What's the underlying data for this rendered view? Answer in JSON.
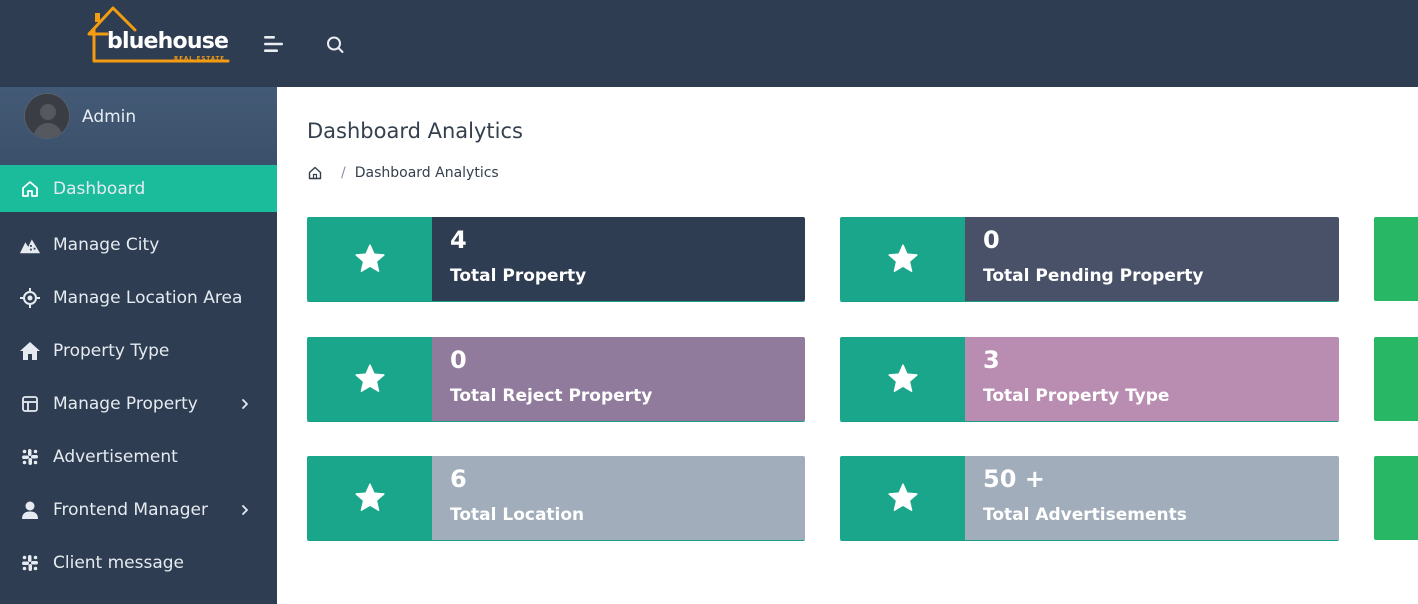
{
  "brand": {
    "name": "bluehouse",
    "tagline": "REAL ESTATE",
    "accent": "#f39c12"
  },
  "topbar": {
    "menu_icon": "menu-icon",
    "search_icon": "search-icon"
  },
  "user": {
    "name": "Admin"
  },
  "nav": [
    {
      "label": "Dashboard",
      "icon": "home-icon",
      "active": true,
      "has_children": false
    },
    {
      "label": "Manage City",
      "icon": "city-icon",
      "active": false,
      "has_children": false
    },
    {
      "label": "Manage Location Area",
      "icon": "location-icon",
      "active": false,
      "has_children": false
    },
    {
      "label": "Property Type",
      "icon": "house-icon",
      "active": false,
      "has_children": false
    },
    {
      "label": "Manage Property",
      "icon": "layout-icon",
      "active": false,
      "has_children": true
    },
    {
      "label": "Advertisement",
      "icon": "slack-icon",
      "active": false,
      "has_children": false
    },
    {
      "label": "Frontend Manager",
      "icon": "user-icon",
      "active": false,
      "has_children": true
    },
    {
      "label": "Client message",
      "icon": "slack-icon",
      "active": false,
      "has_children": false
    }
  ],
  "page": {
    "title": "Dashboard Analytics",
    "breadcrumb": {
      "current": "Dashboard Analytics"
    }
  },
  "stats": [
    {
      "value": "4",
      "label": "Total Property",
      "color": "#2e3d51"
    },
    {
      "value": "0",
      "label": "Total Pending Property",
      "color": "#485168"
    },
    {
      "value": "0",
      "label": "Total Reject Property",
      "color": "#917b9d"
    },
    {
      "value": "3",
      "label": "Total Property Type",
      "color": "#b98db1"
    },
    {
      "value": "6",
      "label": "Total Location",
      "color": "#a1adbb"
    },
    {
      "value": "50 +",
      "label": "Total Advertisements",
      "color": "#a1adbb"
    }
  ],
  "colors": {
    "sidebar": "#2e3d51",
    "active": "#1abc9c",
    "card_icon_bg": "#1aa68a",
    "partial_card": "#28b765"
  }
}
